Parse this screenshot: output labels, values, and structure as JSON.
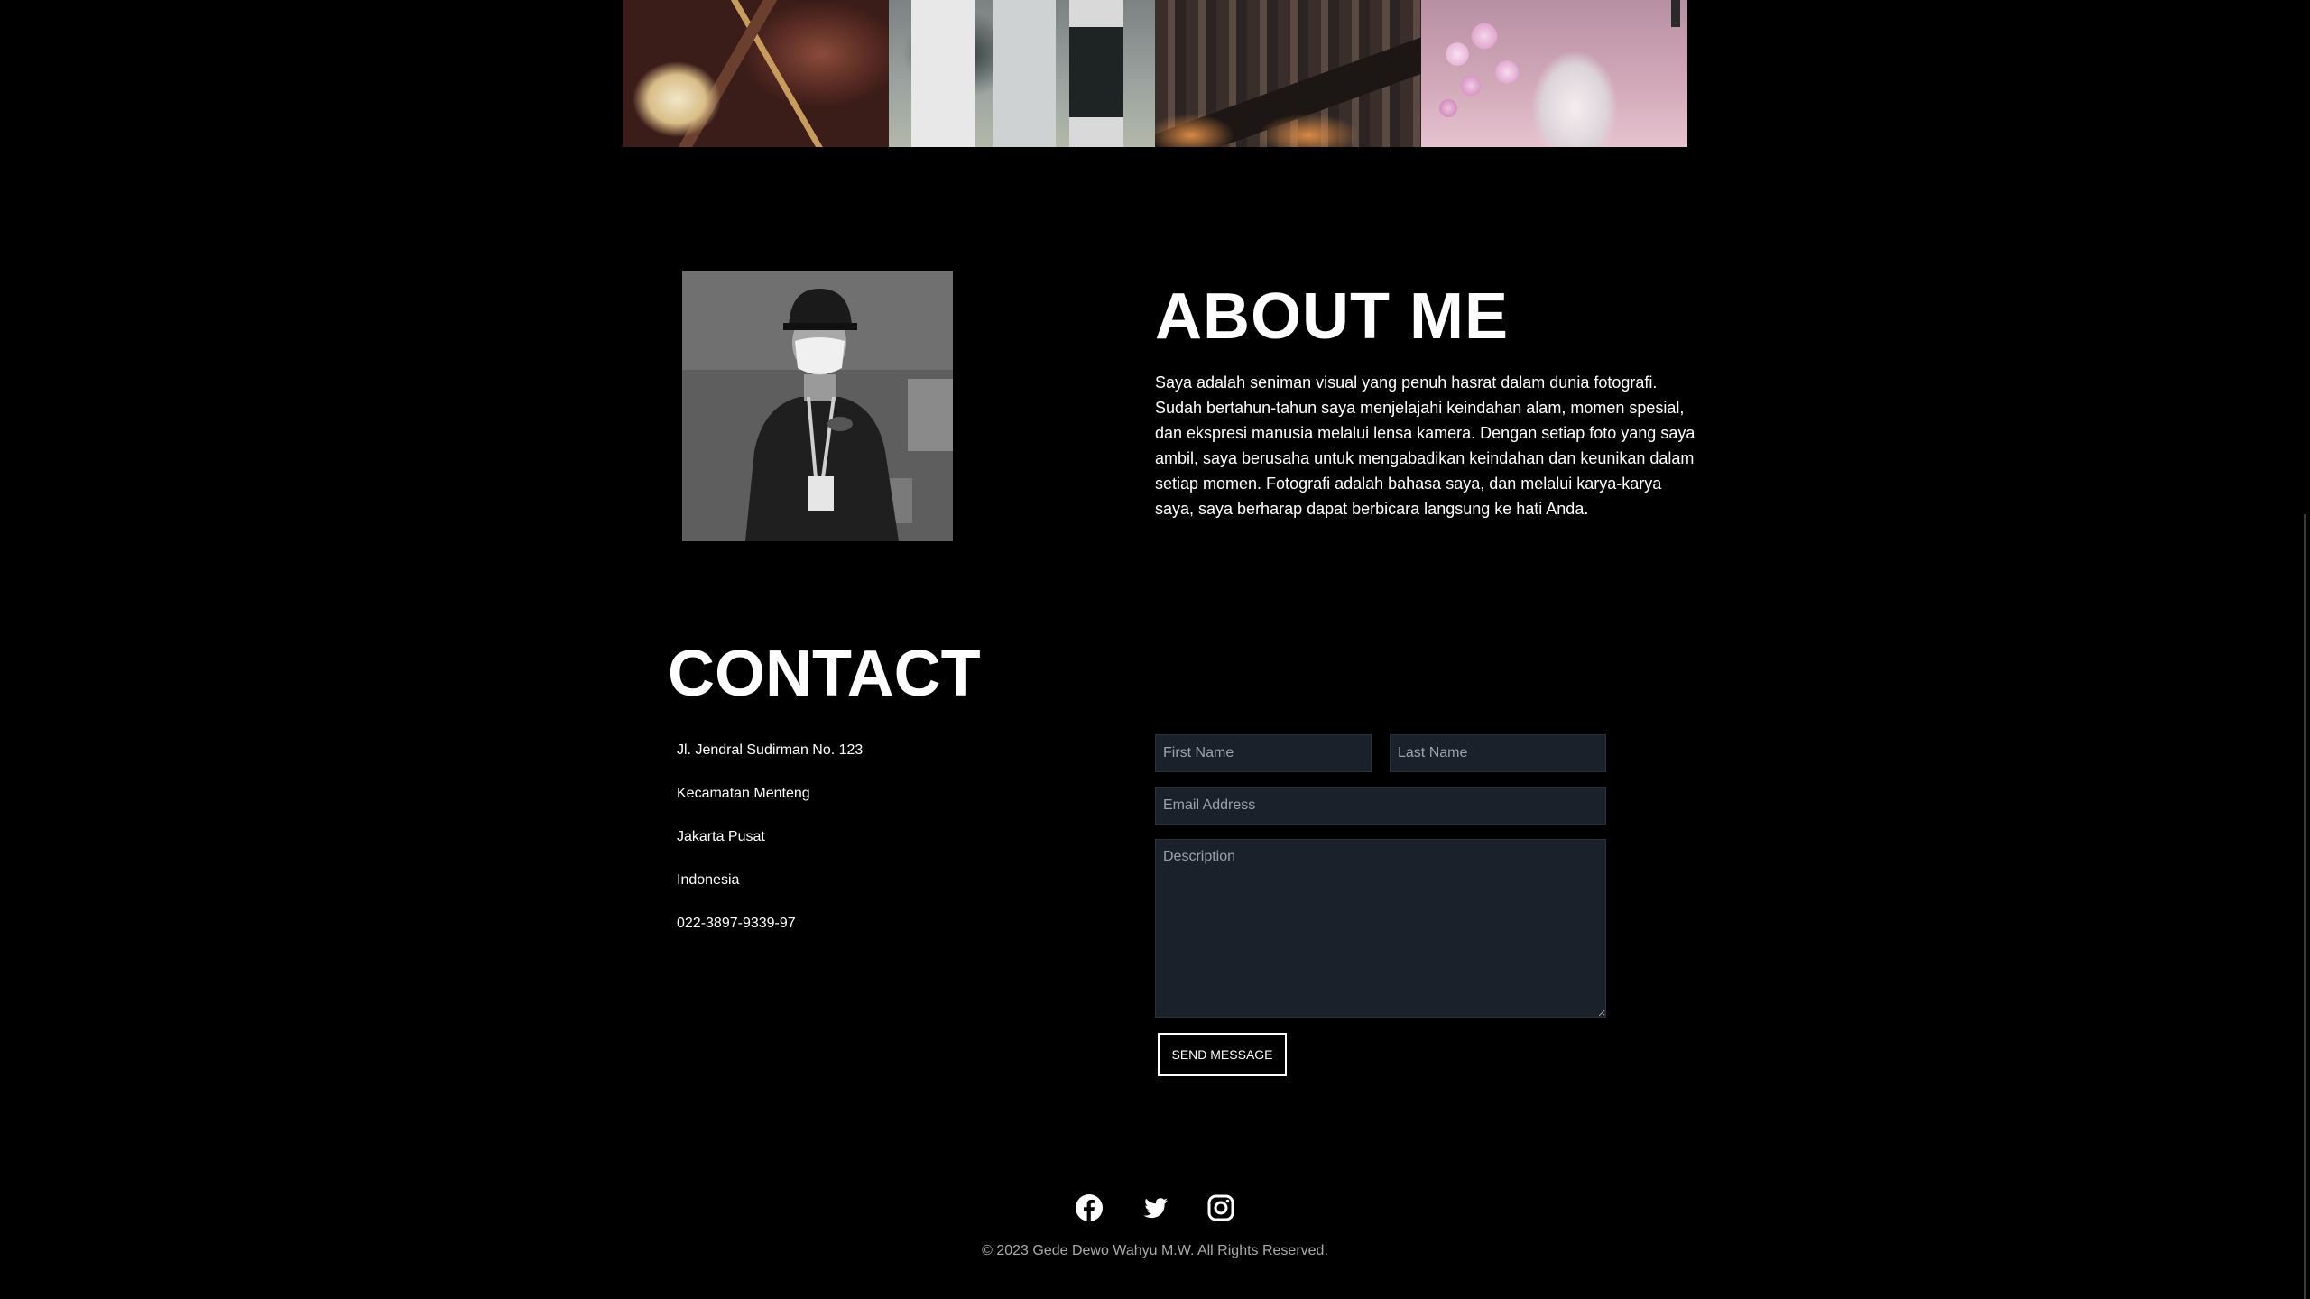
{
  "gallery": {
    "images": [
      {
        "name": "gallery-image-1"
      },
      {
        "name": "gallery-image-2"
      },
      {
        "name": "gallery-image-3"
      },
      {
        "name": "gallery-image-4"
      }
    ]
  },
  "about": {
    "title": "ABOUT ME",
    "text": "Saya adalah seniman visual yang penuh hasrat dalam dunia fotografi. Sudah bertahun-tahun saya menjelajahi keindahan alam, momen spesial, dan ekspresi manusia melalui lensa kamera. Dengan setiap foto yang saya ambil, saya berusaha untuk mengabadikan keindahan dan keunikan dalam setiap momen. Fotografi adalah bahasa saya, dan melalui karya-karya saya, saya berharap dapat berbicara langsung ke hati Anda."
  },
  "contact": {
    "title": "CONTACT",
    "address_lines": [
      "Jl. Jendral Sudirman No. 123",
      "Kecamatan Menteng",
      "Jakarta Pusat",
      "Indonesia",
      "022-3897-9339-97"
    ],
    "form": {
      "first_name_placeholder": "First Name",
      "last_name_placeholder": "Last Name",
      "email_placeholder": "Email Address",
      "description_placeholder": "Description",
      "submit_label": "SEND MESSAGE"
    }
  },
  "footer": {
    "social_icons": [
      "facebook-icon",
      "twitter-icon",
      "instagram-icon"
    ],
    "copyright": "© 2023 Gede Dewo Wahyu M.W. All Rights Reserved."
  },
  "colors": {
    "background": "#000000",
    "text": "#ffffff",
    "input_background": "#1b212b",
    "copyright_text": "#a9a9a9"
  }
}
